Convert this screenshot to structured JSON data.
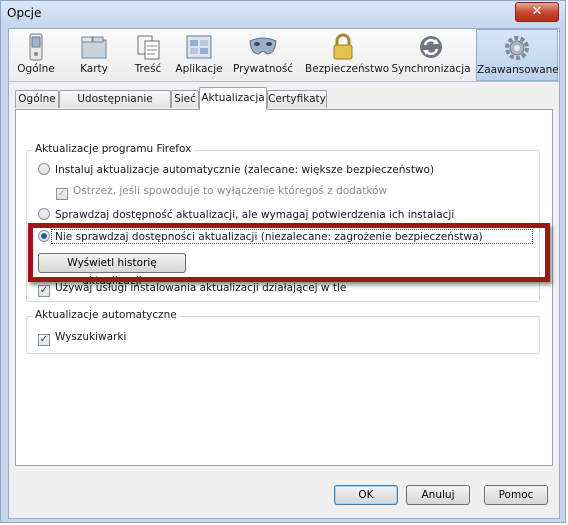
{
  "window": {
    "title": "Opcje",
    "close_glyph": "✕"
  },
  "toolbar": {
    "panes": [
      {
        "label": "Ogólne",
        "icon": "switch-icon",
        "selected": false
      },
      {
        "label": "Karty",
        "icon": "tabs-folder-icon",
        "selected": false
      },
      {
        "label": "Treść",
        "icon": "content-page-icon",
        "selected": false
      },
      {
        "label": "Aplikacje",
        "icon": "applications-icon",
        "selected": false
      },
      {
        "label": "Prywatność",
        "icon": "mask-icon",
        "selected": false
      },
      {
        "label": "Bezpieczeństwo",
        "icon": "padlock-icon",
        "selected": false
      },
      {
        "label": "Synchronizacja",
        "icon": "sync-arrows-icon",
        "selected": false
      },
      {
        "label": "Zaawansowane",
        "icon": "gear-icon",
        "selected": true
      }
    ]
  },
  "tabs": [
    {
      "label": "Ogólne",
      "active": false
    },
    {
      "label": "Udostępnianie danych",
      "active": false
    },
    {
      "label": "Sieć",
      "active": false
    },
    {
      "label": "Aktualizacja",
      "active": true
    },
    {
      "label": "Certyfikaty",
      "active": false
    }
  ],
  "updates_group": {
    "title": "Aktualizacje programu Firefox",
    "options": {
      "auto_install": "Instaluj aktualizacje automatycznie (zalecane: większe bezpieczeństwo)",
      "warn_disable": "Ostrzeż, jeśli spowoduje to wyłączenie któregoś z dodatków",
      "check_ask": "Sprawdzaj dostępność aktualizacji, ale wymagaj potwierdzenia ich instalacji",
      "never_check": "Nie sprawdzaj dostępności aktualizacji (niezalecane: zagrożenie bezpieczeństwa)"
    },
    "selected_option": "never_check",
    "warn_disable_checked": true,
    "history_button": "Wyświetl historię aktualizacji",
    "background_service": "Używaj usługi instalowania aktualizacji działającej w tle",
    "background_service_checked": true
  },
  "auto_group": {
    "title": "Aktualizacje automatyczne",
    "search_engines": "Wyszukiwarki",
    "search_engines_checked": true
  },
  "buttons": {
    "ok": "OK",
    "cancel": "Anuluj",
    "help": "Pomoc"
  },
  "colors": {
    "highlight": "#a01616",
    "selected_pane": "#bcd2ec"
  }
}
